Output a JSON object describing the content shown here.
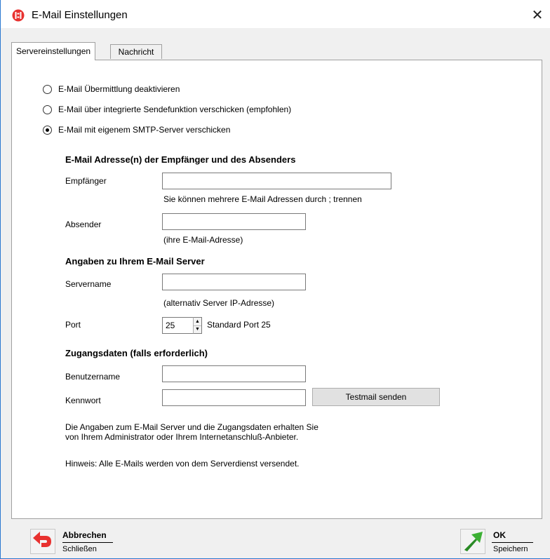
{
  "window": {
    "title": "E-Mail Einstellungen",
    "close_glyph": "✕"
  },
  "tabs": [
    {
      "label": "Servereinstellungen",
      "active": true
    },
    {
      "label": "Nachricht",
      "active": false
    }
  ],
  "delivery_options": [
    {
      "label": "E-Mail Übermittlung deaktivieren",
      "checked": false
    },
    {
      "label": "E-Mail über integrierte Sendefunktion verschicken (empfohlen)",
      "checked": false
    },
    {
      "label": "E-Mail mit eigenem SMTP-Server verschicken",
      "checked": true
    }
  ],
  "addresses": {
    "heading": "E-Mail Adresse(n) der Empfänger und des Absenders",
    "recipient_label": "Empfänger",
    "recipient_value": "",
    "recipient_hint": "Sie können mehrere E-Mail Adressen durch ; trennen",
    "sender_label": "Absender",
    "sender_value": "",
    "sender_hint": "(ihre E-Mail-Adresse)"
  },
  "server": {
    "heading": "Angaben zu Ihrem E-Mail Server",
    "servername_label": "Servername",
    "servername_value": "",
    "servername_hint": "(alternativ Server IP-Adresse)",
    "port_label": "Port",
    "port_value": "25",
    "port_hint": "Standard Port 25"
  },
  "credentials": {
    "heading": "Zugangsdaten (falls erforderlich)",
    "username_label": "Benutzername",
    "username_value": "",
    "password_label": "Kennwort",
    "password_value": "",
    "test_button": "Testmail senden"
  },
  "info": {
    "line1": "Die Angaben zum E-Mail Server und die Zugangsdaten erhalten Sie",
    "line2": "von Ihrem Administrator oder Ihrem Internetanschluß-Anbieter.",
    "note": "Hinweis: Alle E-Mails werden von dem Serverdienst versendet."
  },
  "footer": {
    "cancel_label": "Abbrechen",
    "cancel_sub": "Schließen",
    "ok_label": "OK",
    "ok_sub": "Speichern"
  },
  "icons": {
    "app": "app-logo-icon",
    "cancel": "undo-arrow-icon",
    "ok": "green-arrow-icon"
  },
  "colors": {
    "accent_red": "#e8312f",
    "accent_green": "#3cb034",
    "window_border": "#2b79d1"
  }
}
